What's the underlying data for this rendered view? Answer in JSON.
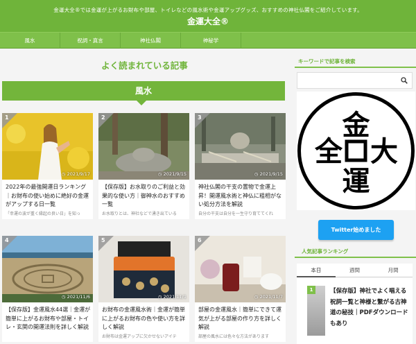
{
  "header": {
    "tagline": "金運大全®では金運が上がるお財布や部屋、トイレなどの風水術や金運アップグッズ、おすすめの神社仏閣をご紹介しています。",
    "site_title": "金運大全®",
    "background_color": "#6fb43a"
  },
  "nav": {
    "items": [
      {
        "label": "風水"
      },
      {
        "label": "祝詞・真言"
      },
      {
        "label": "神社仏閣"
      },
      {
        "label": "神秘学"
      }
    ]
  },
  "main": {
    "popular_heading": "よく読まれている記事",
    "category_banner": "風水",
    "articles": [
      {
        "rank": "1",
        "date": "2021/9/17",
        "title": "2022年の最強開運日ランキング｜お財布の使い始めに絶好の金運がアップする日一覧",
        "excerpt": "「幸運の波が重く縁起の良い日」を知っ"
      },
      {
        "rank": "2",
        "date": "2021/9/15",
        "title": "【保存版】お水取りのご利益と効果的な使い方｜御神水のおすすめ一覧",
        "excerpt": "お水取りとは、神社などで湧き出ている"
      },
      {
        "rank": "3",
        "date": "2021/9/15",
        "title": "神社仏閣の干支の置物で金運上昇！開運風水術と神仏に粗相がない処分方法を解説",
        "excerpt": "自分の干支は自分を一生守り育ててくれ"
      },
      {
        "rank": "4",
        "date": "2021/11/6",
        "title": "【保存版】金運風水44選｜金運が簡単に上がるお財布や部屋・トイレ・玄関の開運法則を詳しく解説",
        "excerpt": ""
      },
      {
        "rank": "5",
        "date": "2021/11/1",
        "title": "お財布の金運風水術｜金運が簡単に上がるお財布の色や使い方を詳しく解説",
        "excerpt": "お財布は金運アップに欠かせないアイテ"
      },
      {
        "rank": "6",
        "date": "2021/11/7",
        "title": "部屋の金運風水｜簡単にできて運気が上がる部屋の作り方を詳しく解説",
        "excerpt": "部屋の風水には色々な方法があります"
      }
    ]
  },
  "sidebar": {
    "keyword_heading": "キーワードで記事を検索",
    "search_placeholder": "",
    "logo_chars": {
      "top": "金",
      "left": "全",
      "right": "大",
      "bottom": "運"
    },
    "twitter_button": "Twitter始めました",
    "ranking_heading": "人気記事ランキング",
    "tabs": [
      {
        "label": "本日",
        "active": true
      },
      {
        "label": "週間",
        "active": false
      },
      {
        "label": "月間",
        "active": false
      }
    ],
    "ranking_item": {
      "rank": "1",
      "title": "【保存版】神社でよく唱える祝詞一覧と神様と繋がる古神道の秘技｜PDFダウンロードもあり"
    }
  },
  "colors": {
    "accent_green": "#6fb43a",
    "twitter_blue": "#1da1f2"
  }
}
